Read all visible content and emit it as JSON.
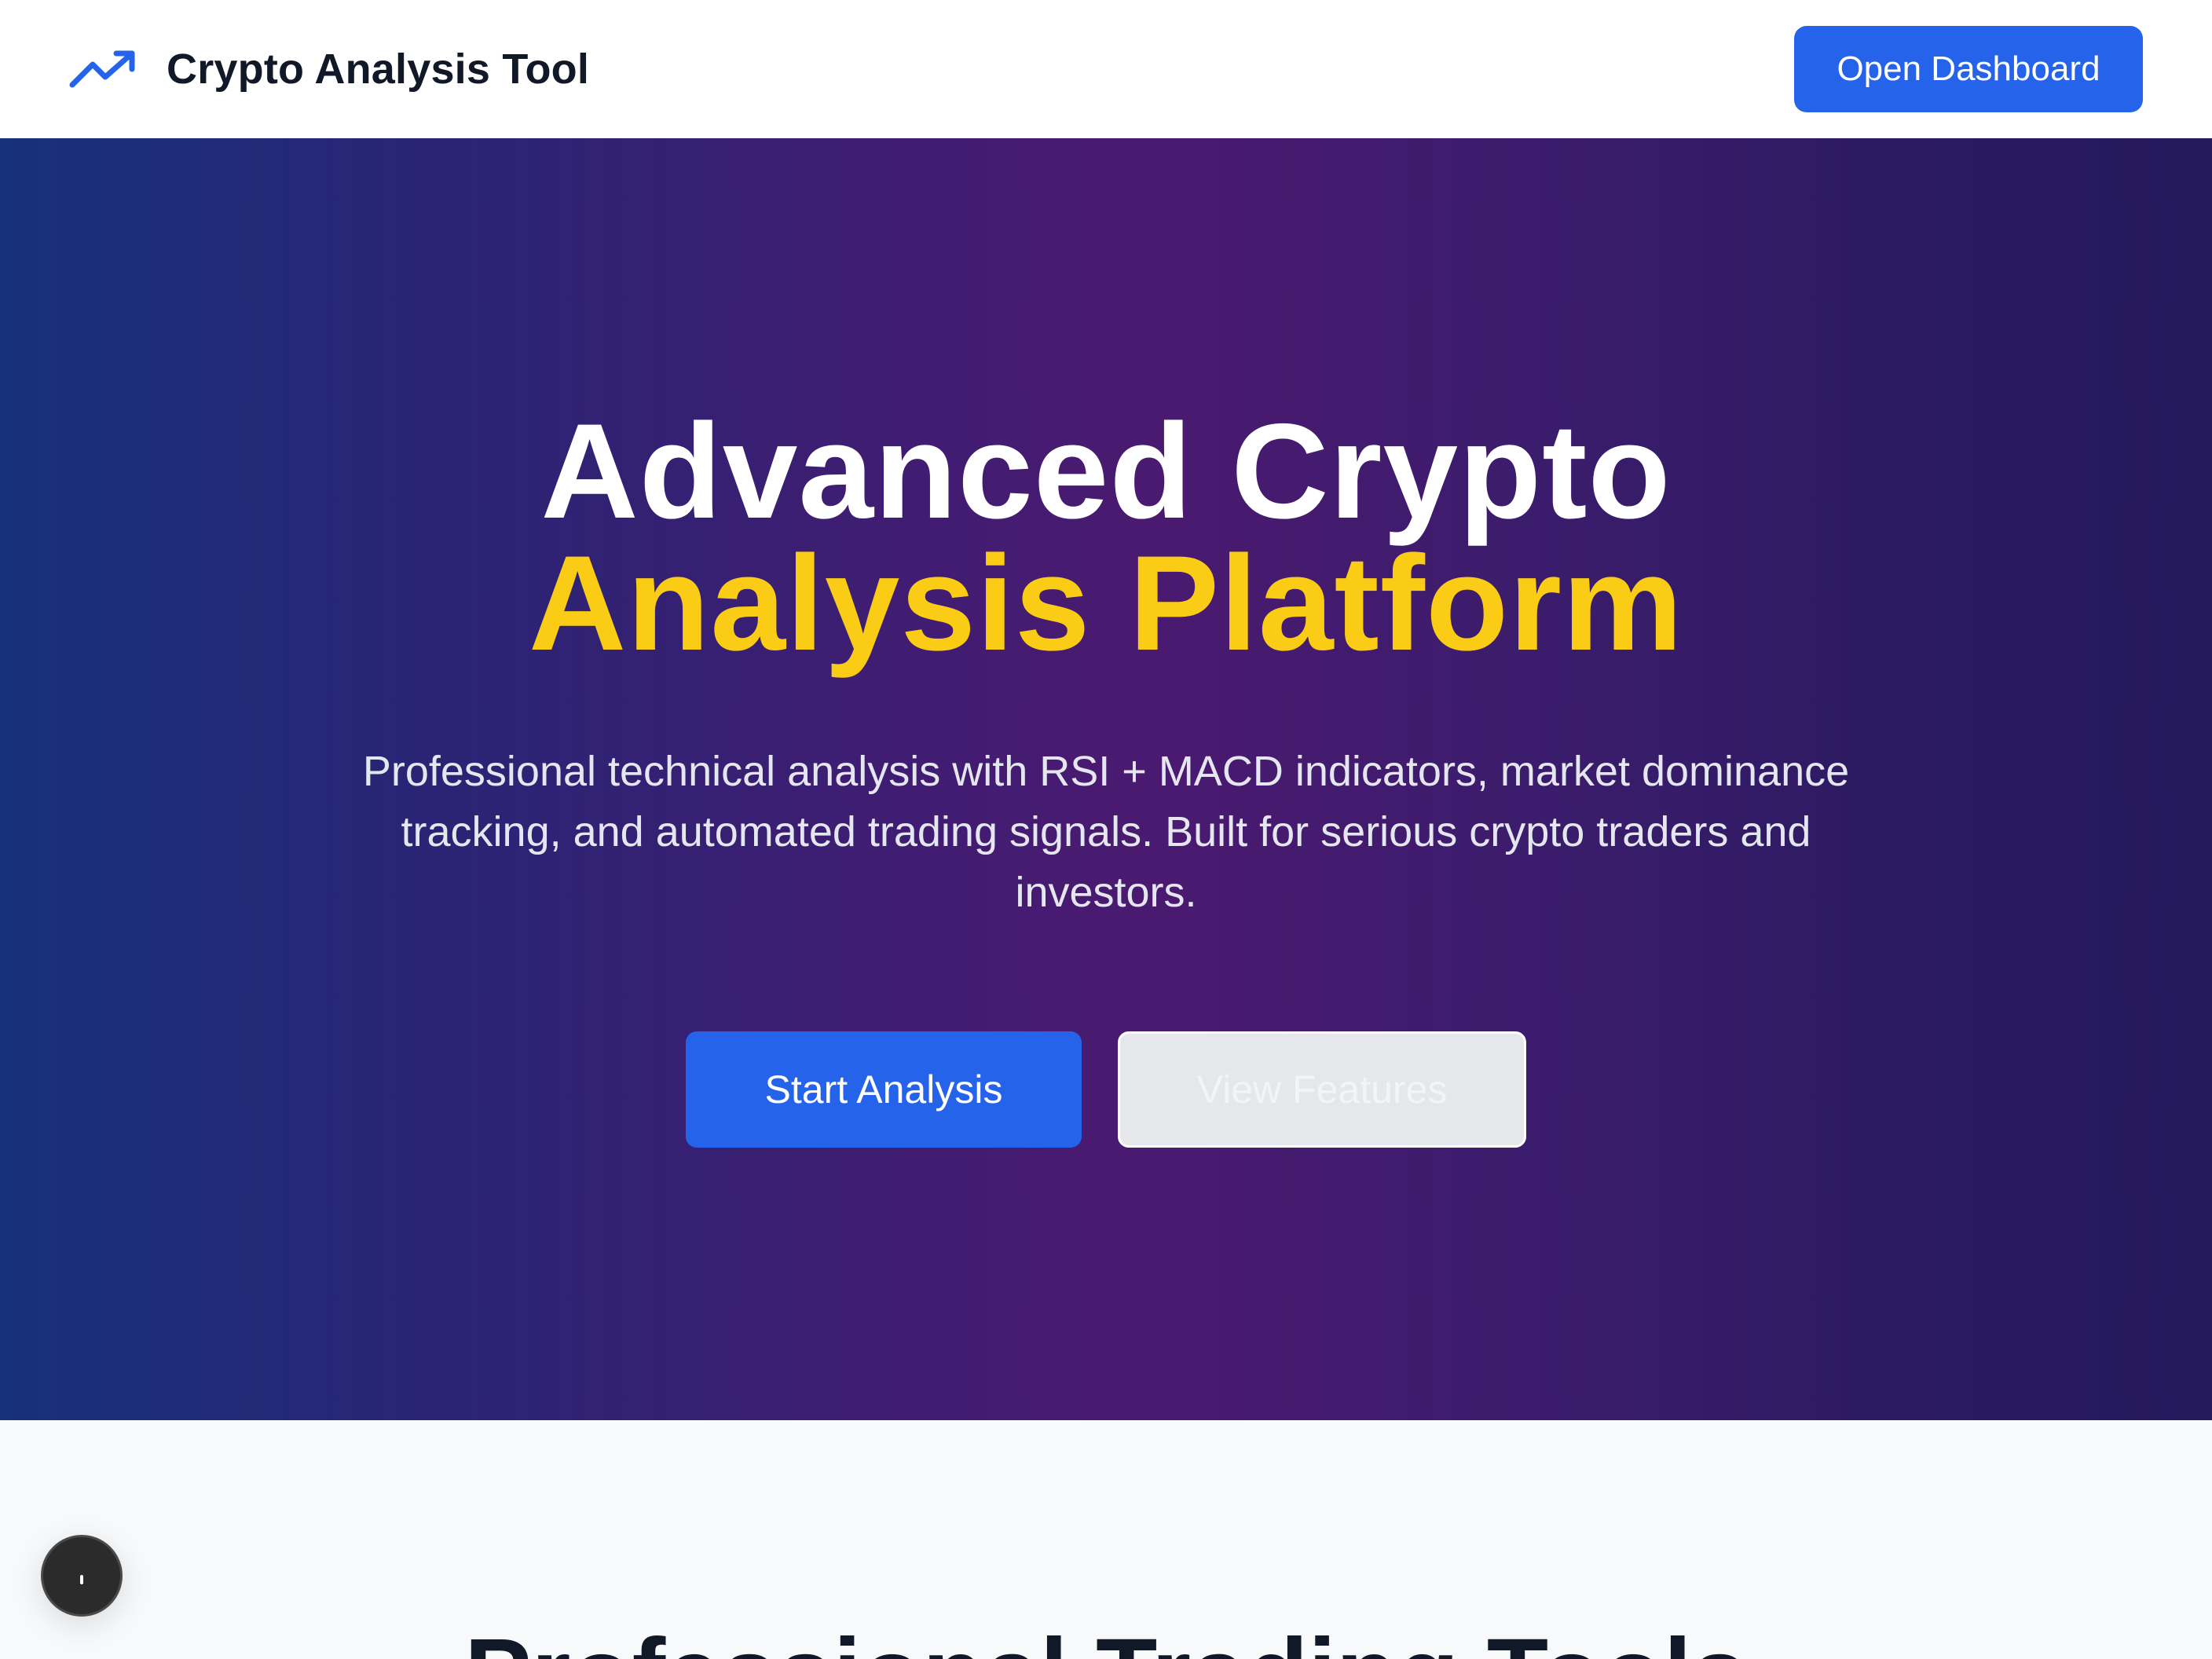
{
  "header": {
    "brand_title": "Crypto Analysis Tool",
    "brand_icon": "trending-up-icon",
    "open_dashboard_label": "Open Dashboard"
  },
  "hero": {
    "title_line1": "Advanced Crypto",
    "title_line2": "Analysis Platform",
    "subtitle": "Professional technical analysis with RSI + MACD indicators, market dominance tracking, and automated trading signals. Built for serious crypto traders and investors.",
    "start_button_label": "Start Analysis",
    "features_button_label": "View Features"
  },
  "section": {
    "heading": "Professional Trading Tools"
  },
  "colors": {
    "primary": "#2563eb",
    "accent": "#facc15",
    "heading_text": "#111827"
  },
  "floating_button": {
    "icon": "chat-icon"
  }
}
